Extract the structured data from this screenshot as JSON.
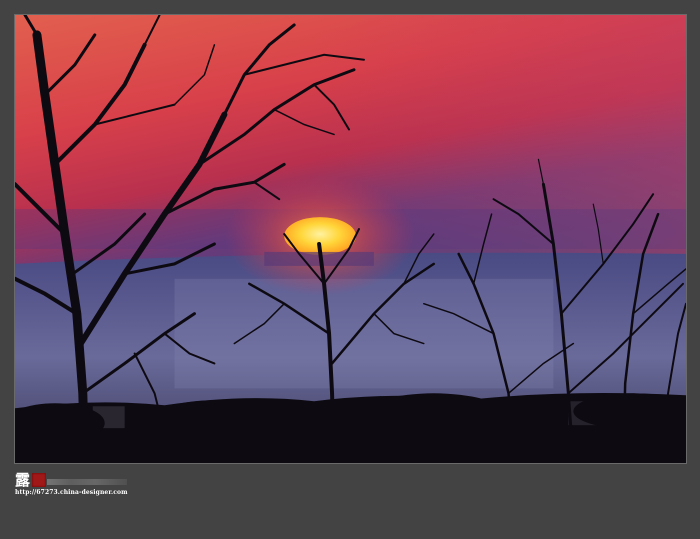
{
  "photo": {
    "subject": "sunset-silhouette",
    "colors": {
      "sky_top": "#e8584a",
      "sky_mid": "#c8304a",
      "sky_low": "#6a3a7a",
      "water": "#5a5a88",
      "sun": "#ffd840",
      "silhouette": "#0e0a12",
      "page_bg": "#434343"
    }
  },
  "watermark": {
    "glyph": "露",
    "url": "http://67273.china-designer.com"
  }
}
